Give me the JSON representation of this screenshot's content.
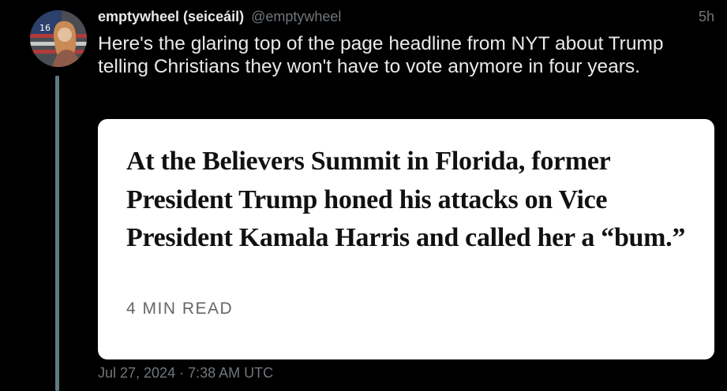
{
  "tweet": {
    "display_name": "emptywheel (seiceáil)",
    "handle": "@emptywheel",
    "timestamp": "5h",
    "text": "Here's the glaring top of the page headline from NYT about Trump telling Christians they won't have to vote anymore in four years.",
    "date": "Jul 27, 2024 · 7:38 AM UTC"
  },
  "media": {
    "headline": "At the Believers Summit in Florida, former President Trump honed his attacks on Vice President Kamala Harris and called her a “bum.”",
    "read_time": "4 MIN READ"
  },
  "colors": {
    "background": "#000000",
    "text_primary": "#e7e9ea",
    "text_secondary": "#71767b",
    "thread_line": "#5f7a82",
    "card_background": "#ffffff",
    "headline_color": "#111111",
    "read_time_color": "#666666"
  },
  "icons": {
    "avatar": "user-avatar-photo"
  }
}
